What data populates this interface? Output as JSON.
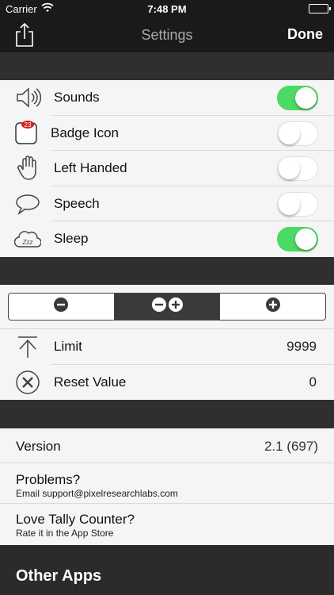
{
  "status": {
    "carrier": "Carrier",
    "time": "7:48 PM"
  },
  "nav": {
    "title": "Settings",
    "done_label": "Done"
  },
  "toggles": [
    {
      "label": "Sounds",
      "icon": "speaker-icon",
      "on": true
    },
    {
      "label": "Badge Icon",
      "icon": "badge-icon",
      "badge": "23",
      "on": false
    },
    {
      "label": "Left Handed",
      "icon": "hand-icon",
      "on": false
    },
    {
      "label": "Speech",
      "icon": "speech-bubble-icon",
      "on": false
    },
    {
      "label": "Sleep",
      "icon": "sleep-cloud-icon",
      "on": true
    }
  ],
  "mode": {
    "options": [
      "minus",
      "minus-plus",
      "plus"
    ],
    "selected": "minus-plus"
  },
  "limits": [
    {
      "label": "Limit",
      "value": "9999",
      "icon": "limit-arrow-icon"
    },
    {
      "label": "Reset Value",
      "value": "0",
      "icon": "reset-x-icon"
    }
  ],
  "info": {
    "version_label": "Version",
    "version_value": "2.1 (697)",
    "problems_title": "Problems?",
    "problems_sub": "Email support@pixelresearchlabs.com",
    "rate_title": "Love Tally Counter?",
    "rate_sub": "Rate it in the App Store"
  },
  "other_apps": {
    "heading": "Other Apps"
  },
  "colors": {
    "toggle_on": "#4cd964",
    "dark_bg": "#2b2b2b",
    "bar_bg": "#1a1a1a"
  }
}
